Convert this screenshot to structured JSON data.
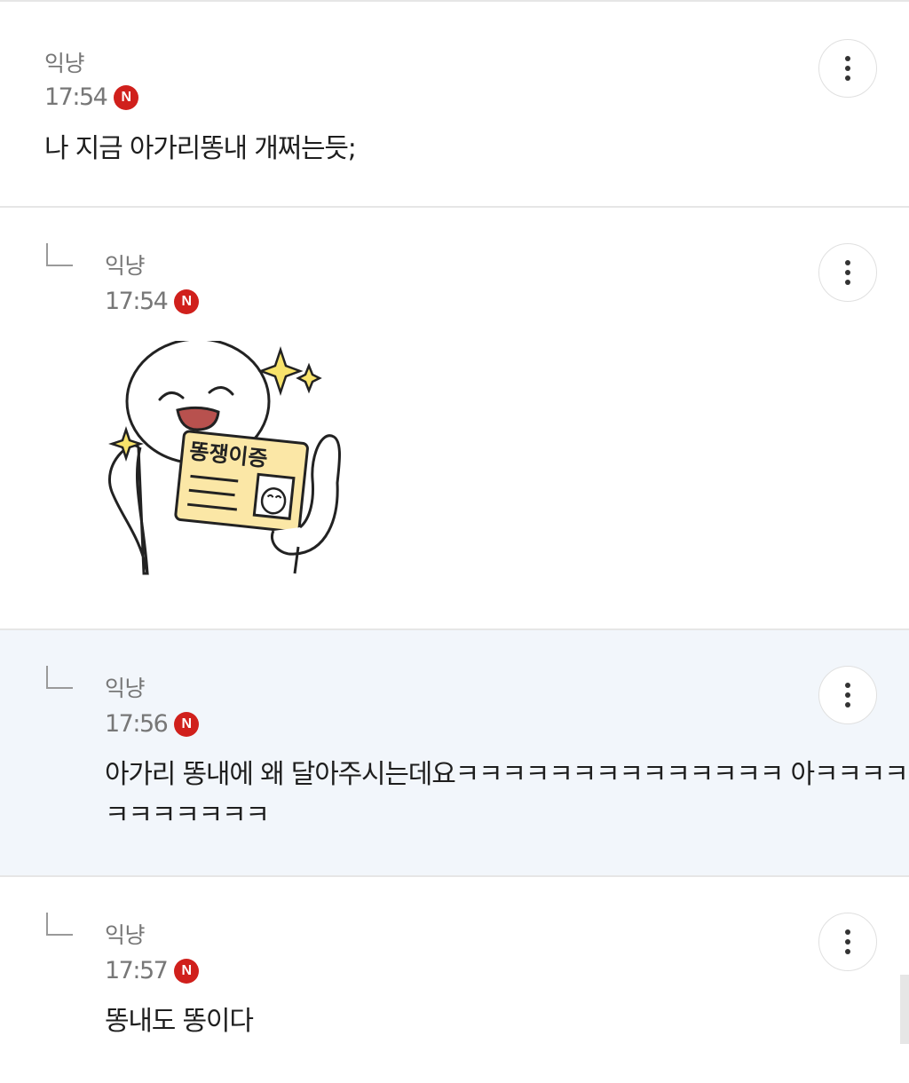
{
  "comments": [
    {
      "author": "익냥",
      "time": "17:54",
      "badge": "N",
      "text": "나 지금 아가리똥내 개쩌는듯;"
    },
    {
      "author": "익냥",
      "time": "17:54",
      "badge": "N",
      "sticker": {
        "description_icon": "sticker-icon",
        "card_text": "똥쟁이증"
      }
    },
    {
      "author": "익냥",
      "time": "17:56",
      "badge": "N",
      "text_line1": "아가리 똥내에 왜 달아주시는데요ㅋㅋㅋㅋㅋㅋㅋㅋㅋㅋㅋㅋㅋㅋ 아ㅋㅋㅋㅋㅋ",
      "text_line2": "ㅋㅋㅋㅋㅋㅋㅋ"
    },
    {
      "author": "익냥",
      "time": "17:57",
      "badge": "N",
      "text": "똥내도 똥이다"
    }
  ],
  "colors": {
    "badge": "#d0201c",
    "highlight_bg": "#f2f6fb",
    "divider": "#e6e6e6",
    "sticker_card": "#fbe7a6"
  },
  "icons": {
    "more": "more-vertical-icon",
    "reply": "reply-indent-icon"
  }
}
